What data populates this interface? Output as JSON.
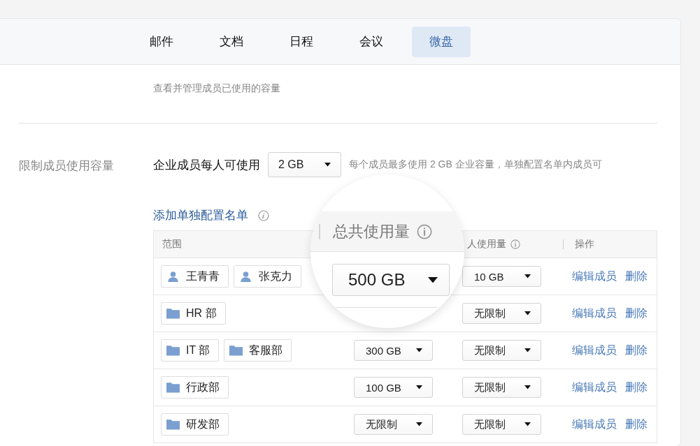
{
  "tabs": [
    {
      "label": "邮件",
      "selected": false
    },
    {
      "label": "文档",
      "selected": false
    },
    {
      "label": "日程",
      "selected": false
    },
    {
      "label": "会议",
      "selected": false
    },
    {
      "label": "微盘",
      "selected": true
    }
  ],
  "description": "查看并管理成员已使用的容量",
  "limit_section": {
    "label": "限制成员使用容量",
    "per_member_label": "企业成员每人可使用",
    "per_member_value": "2 GB",
    "note": "每个成员最多使用 2 GB 企业容量，单独配置名单内成员可"
  },
  "add_list_link": "添加单独配置名单",
  "table": {
    "columns": [
      {
        "label": "范围"
      },
      {
        "label": "人使用量",
        "info": true
      },
      {
        "label": "操作"
      }
    ],
    "rows": [
      {
        "members": [
          {
            "name": "王青青",
            "kind": "person"
          },
          {
            "name": "张克力",
            "kind": "person"
          }
        ],
        "per_person": "10 GB",
        "actions": [
          "编辑成员",
          "删除"
        ]
      },
      {
        "members": [
          {
            "name": "HR 部",
            "kind": "department"
          }
        ],
        "per_person": "无限制",
        "actions": [
          "编辑成员",
          "删除"
        ]
      },
      {
        "members": [
          {
            "name": "IT 部",
            "kind": "department"
          },
          {
            "name": "客服部",
            "kind": "department"
          }
        ],
        "total": "300 GB",
        "per_person": "无限制",
        "actions": [
          "编辑成员",
          "删除"
        ]
      },
      {
        "members": [
          {
            "name": "行政部",
            "kind": "department"
          }
        ],
        "total": "100 GB",
        "per_person": "无限制",
        "actions": [
          "编辑成员",
          "删除"
        ]
      },
      {
        "members": [
          {
            "name": "研发部",
            "kind": "department"
          }
        ],
        "total": "无限制",
        "per_person": "无限制",
        "actions": [
          "编辑成员",
          "删除"
        ]
      }
    ]
  },
  "magnifier": {
    "column": "总共使用量",
    "value": "500 GB"
  }
}
